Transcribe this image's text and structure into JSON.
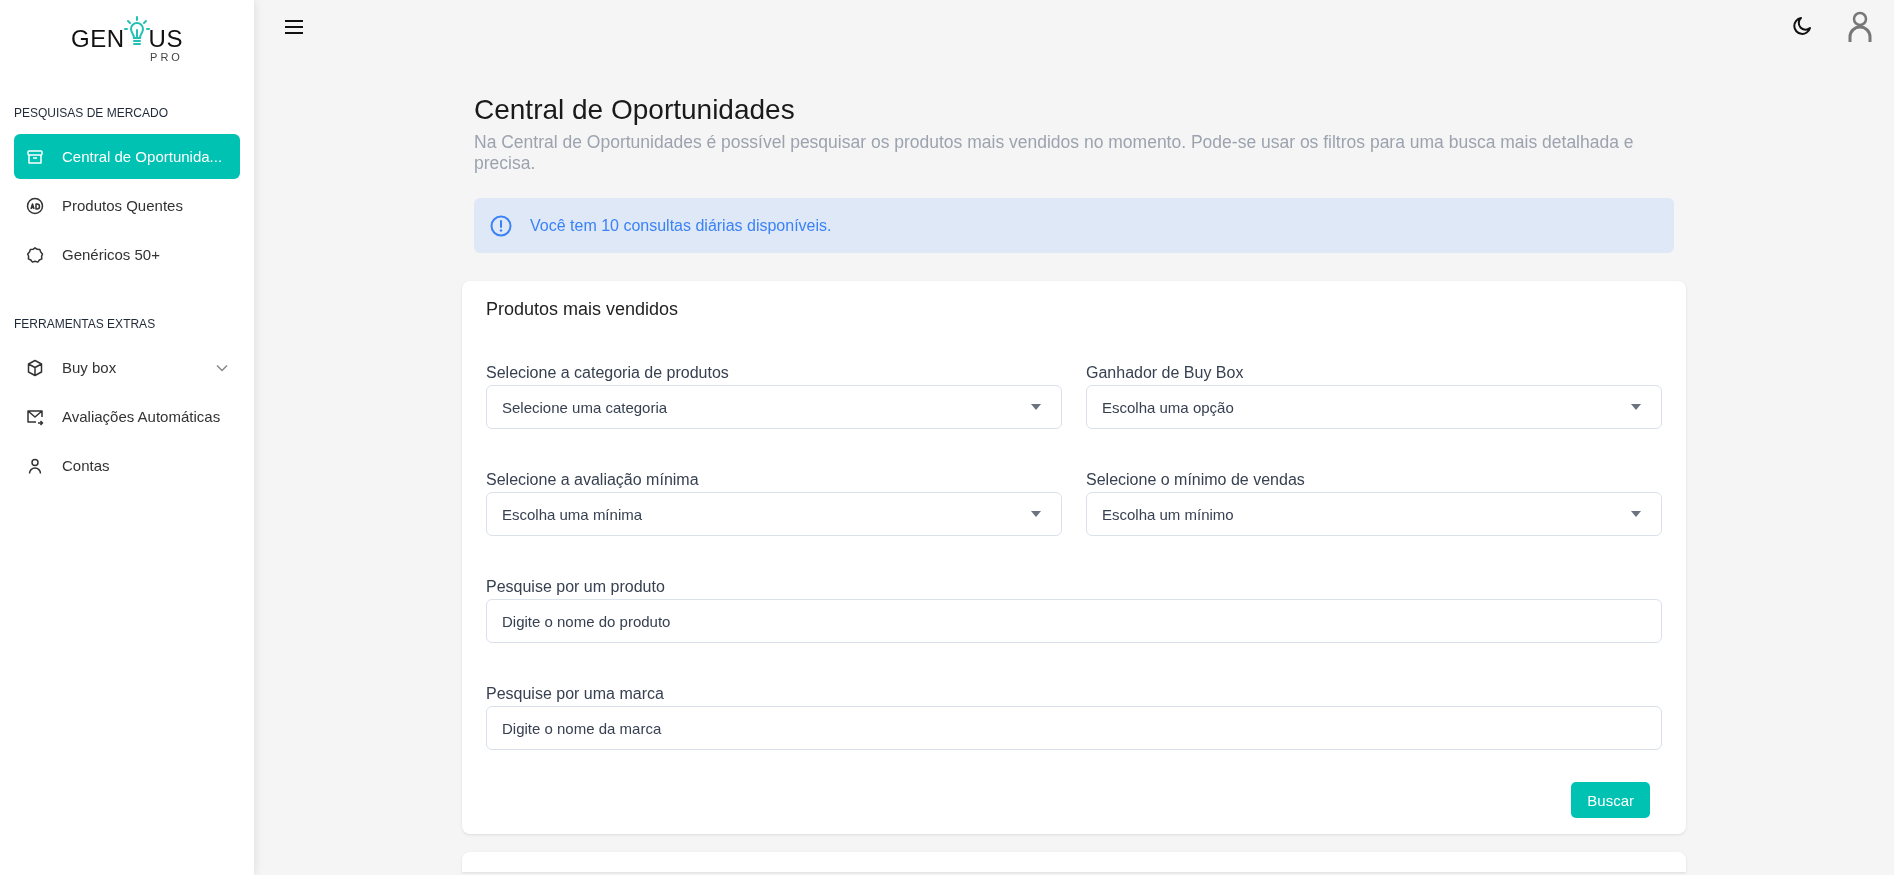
{
  "logo": {
    "left": "GEN",
    "right": "US",
    "sub": "PRO"
  },
  "sidebar": {
    "sections": [
      {
        "title": "PESQUISAS DE MERCADO",
        "items": [
          {
            "label": "Central de Oportunida...",
            "selected": true
          },
          {
            "label": "Produtos Quentes",
            "selected": false
          },
          {
            "label": "Genéricos 50+",
            "selected": false
          }
        ]
      },
      {
        "title": "FERRAMENTAS EXTRAS",
        "items": [
          {
            "label": "Buy box",
            "selected": false,
            "expanded": false
          },
          {
            "label": "Avaliações Automáticas",
            "selected": false
          },
          {
            "label": "Contas",
            "selected": false
          }
        ]
      }
    ]
  },
  "page": {
    "title": "Central de Oportunidades",
    "description": "Na Central de Oportunidades é possível pesquisar os produtos mais vendidos no momento. Pode-se usar os filtros para uma busca mais detalhada e precisa."
  },
  "alert": {
    "text": "Você tem 10 consultas diárias disponíveis."
  },
  "card": {
    "title": "Produtos mais vendidos",
    "fields": [
      {
        "kind": "select",
        "label": "Selecione a categoria de produtos",
        "value": "Selecione uma categoria"
      },
      {
        "kind": "select",
        "label": "Ganhador de Buy Box",
        "value": "Escolha uma opção"
      },
      {
        "kind": "select",
        "label": "Selecione a avaliação mínima",
        "value": "Escolha uma mínima"
      },
      {
        "kind": "select",
        "label": "Selecione o mínimo de vendas",
        "value": "Escolha um mínimo"
      },
      {
        "kind": "text",
        "label": "Pesquise por um produto",
        "placeholder": "Digite o nome do produto"
      },
      {
        "kind": "text",
        "label": "Pesquise por uma marca",
        "placeholder": "Digite o nome da marca"
      }
    ],
    "button": "Buscar"
  }
}
